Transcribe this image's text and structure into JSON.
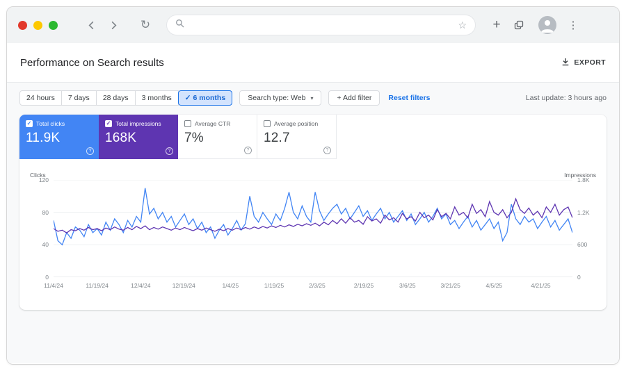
{
  "browser": {
    "traffic_lights": {
      "close": "#e2382b",
      "minimize": "#fdc800",
      "maximize": "#2bb830"
    },
    "address_value": ""
  },
  "header": {
    "title": "Performance on Search results",
    "export_label": "EXPORT"
  },
  "filters": {
    "date_ranges": [
      {
        "label": "24 hours",
        "selected": false
      },
      {
        "label": "7 days",
        "selected": false
      },
      {
        "label": "28 days",
        "selected": false
      },
      {
        "label": "3 months",
        "selected": false
      },
      {
        "label": "6 months",
        "selected": true
      }
    ],
    "search_type_label": "Search type: Web",
    "add_filter_label": "+ Add filter",
    "reset_filters_label": "Reset filters",
    "last_update": "Last update: 3 hours ago"
  },
  "metrics": [
    {
      "id": "total-clicks",
      "label": "Total clicks",
      "value": "11.9K",
      "checked": true,
      "bg": "#4285f4"
    },
    {
      "id": "total-impressions",
      "label": "Total impressions",
      "value": "168K",
      "checked": true,
      "bg": "#5e35b1"
    },
    {
      "id": "average-ctr",
      "label": "Average CTR",
      "value": "7%",
      "checked": false,
      "bg": "#ffffff"
    },
    {
      "id": "average-position",
      "label": "Average position",
      "value": "12.7",
      "checked": false,
      "bg": "#ffffff"
    }
  ],
  "chart_data": {
    "type": "line",
    "title": "Performance on Search results",
    "grid": true,
    "left_axis": {
      "label": "Clicks",
      "range": [
        0,
        120
      ],
      "tick_values": [
        0,
        40,
        80,
        120
      ],
      "tick_labels": [
        "0",
        "40",
        "80",
        "120"
      ]
    },
    "right_axis": {
      "label": "Impressions",
      "range": [
        0,
        1800
      ],
      "tick_values": [
        0,
        600,
        1200,
        1800
      ],
      "tick_labels": [
        "0",
        "600",
        "1.2K",
        "1.8K"
      ]
    },
    "x_tick_labels": [
      "11/4/24",
      "11/19/24",
      "12/4/24",
      "12/19/24",
      "1/4/25",
      "1/19/25",
      "2/3/25",
      "2/19/25",
      "3/6/25",
      "3/21/25",
      "4/5/25",
      "4/21/25"
    ],
    "x_tick_fractions": [
      0,
      0.084,
      0.168,
      0.251,
      0.341,
      0.425,
      0.508,
      0.598,
      0.682,
      0.765,
      0.849,
      0.939
    ],
    "series": [
      {
        "name": "Clicks",
        "axis": "left",
        "color": "#4285f4",
        "total": "11.9K",
        "values": [
          70,
          45,
          40,
          55,
          48,
          62,
          58,
          50,
          65,
          55,
          60,
          52,
          68,
          58,
          72,
          65,
          55,
          70,
          62,
          75,
          68,
          110,
          78,
          85,
          72,
          80,
          68,
          75,
          62,
          70,
          78,
          65,
          72,
          60,
          68,
          55,
          62,
          48,
          58,
          65,
          52,
          60,
          70,
          58,
          66,
          100,
          75,
          68,
          80,
          72,
          65,
          78,
          70,
          85,
          105,
          80,
          72,
          88,
          75,
          68,
          105,
          82,
          70,
          78,
          85,
          90,
          78,
          85,
          72,
          80,
          88,
          75,
          82,
          70,
          78,
          85,
          72,
          80,
          68,
          75,
          82,
          70,
          78,
          65,
          72,
          80,
          68,
          75,
          85,
          72,
          78,
          65,
          70,
          60,
          68,
          75,
          62,
          70,
          58,
          65,
          72,
          60,
          68,
          45,
          55,
          90,
          72,
          65,
          75,
          68,
          72,
          60,
          68,
          75,
          62,
          70,
          58,
          65,
          72,
          55
        ]
      },
      {
        "name": "Impressions",
        "axis": "right",
        "color": "#5e35b1",
        "total": "168K",
        "values": [
          900,
          850,
          870,
          820,
          880,
          860,
          900,
          870,
          920,
          880,
          900,
          860,
          910,
          880,
          930,
          890,
          870,
          920,
          880,
          940,
          900,
          950,
          880,
          920,
          890,
          930,
          900,
          870,
          910,
          880,
          920,
          890,
          860,
          900,
          870,
          910,
          880,
          850,
          890,
          860,
          900,
          870,
          910,
          880,
          920,
          890,
          930,
          900,
          940,
          910,
          950,
          920,
          960,
          930,
          970,
          940,
          980,
          950,
          990,
          960,
          1000,
          950,
          1020,
          970,
          1050,
          990,
          1080,
          1000,
          1100,
          1020,
          1050,
          980,
          1120,
          1040,
          1080,
          1000,
          1150,
          1060,
          1100,
          1020,
          1180,
          1080,
          1120,
          1040,
          1200,
          1100,
          1150,
          1060,
          1250,
          1120,
          1180,
          1080,
          1300,
          1150,
          1200,
          1100,
          1350,
          1180,
          1250,
          1120,
          1400,
          1200,
          1150,
          1250,
          1100,
          1200,
          1450,
          1250,
          1180,
          1280,
          1150,
          1220,
          1100,
          1300,
          1200,
          1350,
          1150,
          1250,
          1300,
          1100
        ]
      }
    ],
    "summary": {
      "average_ctr": "7%",
      "average_position": "12.7"
    }
  }
}
